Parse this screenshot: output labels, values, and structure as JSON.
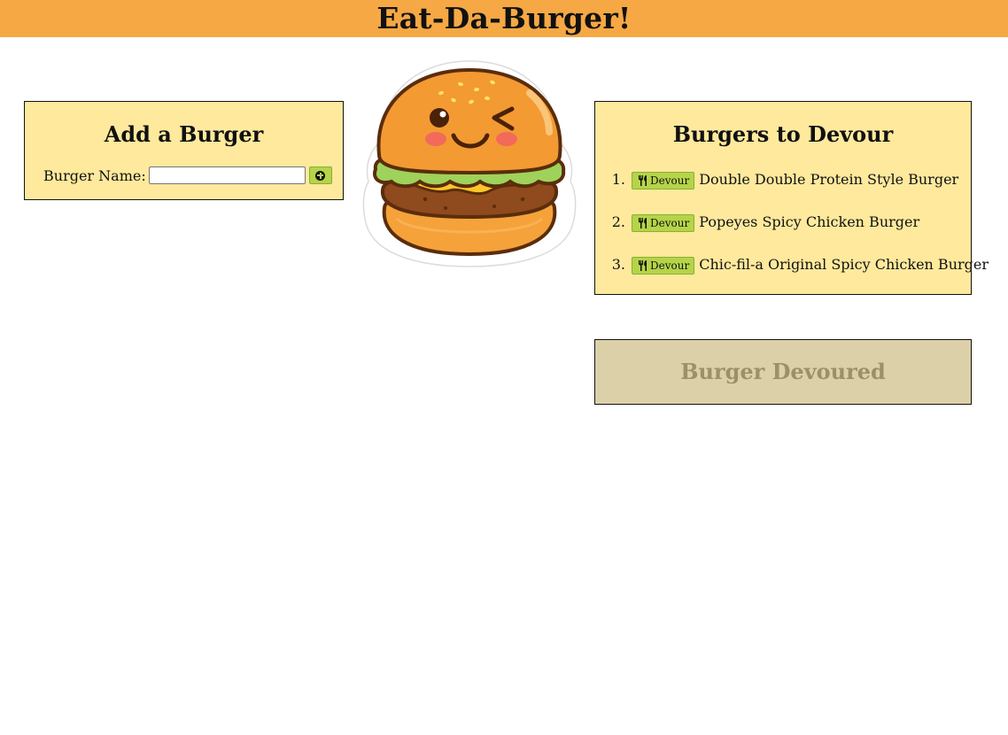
{
  "header": {
    "title": "Eat-Da-Burger!"
  },
  "add_panel": {
    "title": "Add a Burger",
    "name_label": "Burger Name:",
    "name_value": "",
    "name_placeholder": ""
  },
  "devour_panel": {
    "title": "Burgers to Devour",
    "button_label": "Devour",
    "items": [
      {
        "number": "1.",
        "name": "Double Double Protein Style Burger"
      },
      {
        "number": "2.",
        "name": "Popeyes Spicy Chicken Burger"
      },
      {
        "number": "3.",
        "name": "Chic-fil-a Original Spicy Chicken Burger"
      }
    ]
  },
  "devoured_panel": {
    "title": "Burger Devoured"
  },
  "icons": {
    "add": "plus-circle-icon",
    "devour": "utensils-icon",
    "mascot": "burger-mascot-icon"
  },
  "colors": {
    "header_bg": "#f5a844",
    "panel_bg": "#ffe99d",
    "devoured_bg": "#dcd0a9",
    "button_bg": "#b5d449"
  }
}
